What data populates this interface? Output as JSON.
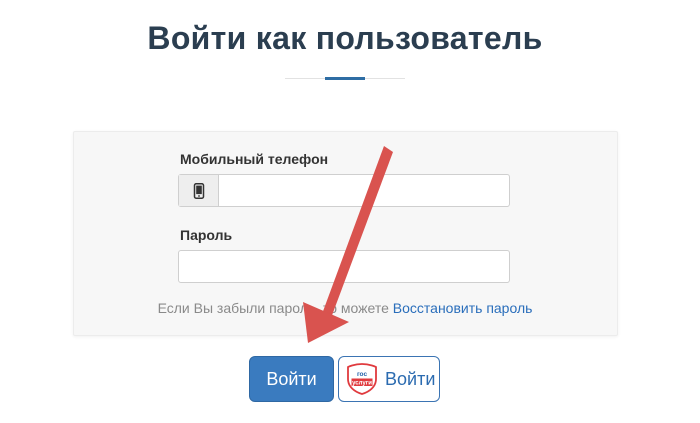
{
  "page": {
    "title": "Войти как пользователь"
  },
  "form": {
    "phone_label": "Мобильный телефон",
    "phone_value": "",
    "password_label": "Пароль",
    "password_value": "",
    "forgot_text": "Если Вы забыли пароль, то можете",
    "restore_link": "Восстановить пароль"
  },
  "buttons": {
    "login_label": "Войти",
    "gosuslugi_label": "Войти",
    "gosuslugi_logo_text": [
      "гос",
      "услуги"
    ]
  },
  "icons": {
    "phone": "mobile-phone-icon",
    "gosuslugi": "gosuslugi-logo-icon",
    "annotation": "red-arrow"
  },
  "colors": {
    "title": "#2b3e50",
    "accent": "#2e6da4",
    "primary_button": "#3a7bbf",
    "link": "#2a6ebb",
    "arrow": "#d9534f",
    "gosuslugi_red": "#e03a3e",
    "gosuslugi_blue": "#1f5fa8"
  }
}
